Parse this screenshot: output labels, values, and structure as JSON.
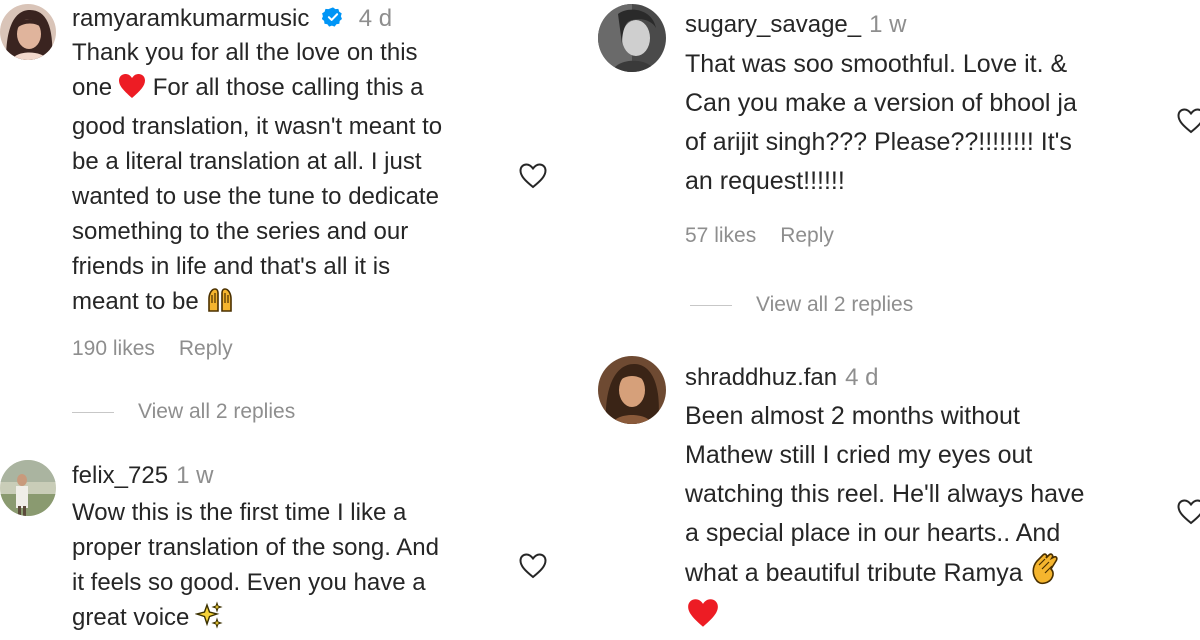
{
  "comments": [
    {
      "username": "ramyaramkumarmusic",
      "time": "4 d",
      "verified": true,
      "lines": [
        "Thank you for all the love on this",
        "one",
        " For all those calling this a",
        "good translation, it wasn't meant to",
        "be a literal translation at all. I just",
        "wanted to use the tune to dedicate",
        "something to the series and our",
        "friends in life and that's all it is",
        "meant to be"
      ],
      "likes": "190 likes",
      "reply": "Reply",
      "view_replies": "View all 2 replies"
    },
    {
      "username": "felix_725",
      "time": "1 w",
      "lines": [
        "Wow this is the first time I like a",
        "proper translation of the song. And",
        "it feels so good. Even you have a",
        "great voice"
      ]
    },
    {
      "username": "sugary_savage_",
      "time": "1 w",
      "lines": [
        "That was soo smoothful. Love it. &",
        "Can you make a version of bhool ja",
        "of arijit singh??? Please??!!!!!!!! It's",
        "an request!!!!!!"
      ],
      "likes": "57 likes",
      "reply": "Reply",
      "view_replies": "View all 2 replies"
    },
    {
      "username": "shraddhuz.fan",
      "time": "4 d",
      "lines": [
        "Been almost 2 months without",
        "Mathew still I cried my eyes out",
        "watching this reel. He'll always have",
        "a special place in our hearts.. And",
        "what a beautiful tribute Ramya"
      ]
    }
  ],
  "icons": {
    "like": "heart-outline-icon",
    "verified": "verified-badge-icon",
    "red_heart": "red-heart-emoji-icon",
    "raised_hands": "raised-hands-emoji-icon",
    "sparkles": "sparkles-emoji-icon",
    "clapping": "clapping-hands-emoji-icon"
  },
  "colors": {
    "text": "#262626",
    "secondary": "#8e8e8e",
    "verified": "#0095f6",
    "heart": "#ed1c24"
  }
}
